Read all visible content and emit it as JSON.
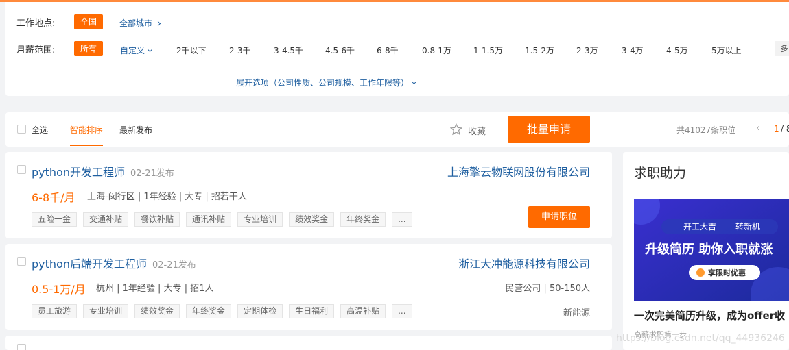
{
  "filter": {
    "location_label": "工作地点:",
    "location_selected": "全国",
    "all_cities": "全部城市",
    "salary_label": "月薪范围:",
    "salary_selected": "所有",
    "salary_custom": "自定义",
    "salary_options": [
      "2千以下",
      "2-3千",
      "3-4.5千",
      "4.5-6千",
      "6-8千",
      "0.8-1万",
      "1-1.5万",
      "1.5-2万",
      "2-3万",
      "3-4万",
      "4-5万",
      "5万以上"
    ],
    "more_label": "多",
    "expand_label": "展开选项（公司性质、公司规模、工作年限等）"
  },
  "toolbar": {
    "select_all": "全选",
    "sort_smart": "智能排序",
    "sort_latest": "最新发布",
    "favorite": "收藏",
    "batch_apply": "批量申请",
    "total": "共41027条职位",
    "page_current": "1",
    "page_sep": "/ 8"
  },
  "jobs": [
    {
      "title": "python开发工程师",
      "date": "02-21发布",
      "company": "上海擎云物联网股份有限公司",
      "salary": "6-8千/月",
      "meta": "上海-闵行区 | 1年经验 | 大专 | 招若干人",
      "tags": [
        "五险一金",
        "交通补贴",
        "餐饮补贴",
        "通讯补贴",
        "专业培训",
        "绩效奖金",
        "年终奖金",
        "..."
      ],
      "apply": "申请职位"
    },
    {
      "title": "python后端开发工程师",
      "date": "02-21发布",
      "company": "浙江大冲能源科技有限公司",
      "salary": "0.5-1万/月",
      "meta": "杭州 | 1年经验 | 大专 | 招1人",
      "company_meta": "民营公司 | 50-150人",
      "industry": "新能源",
      "tags": [
        "员工旅游",
        "专业培训",
        "绩效奖金",
        "年终奖金",
        "定期体检",
        "生日福利",
        "高温补贴",
        "..."
      ]
    }
  ],
  "side": {
    "title": "求职助力",
    "banner_top": "开工大吉",
    "banner_top2": "转新机",
    "banner_main": "升级简历 助你入职就涨",
    "banner_badge": "享限时优惠",
    "promo_title": "一次完美简历升级，成为offer收",
    "promo_sub": "高薪求职第一步"
  },
  "watermark": "https://blog.csdn.net/qq_44936246",
  "colors": {
    "accent": "#ff6a00",
    "link": "#1f5fa0",
    "banner": "#2b2fb8"
  }
}
